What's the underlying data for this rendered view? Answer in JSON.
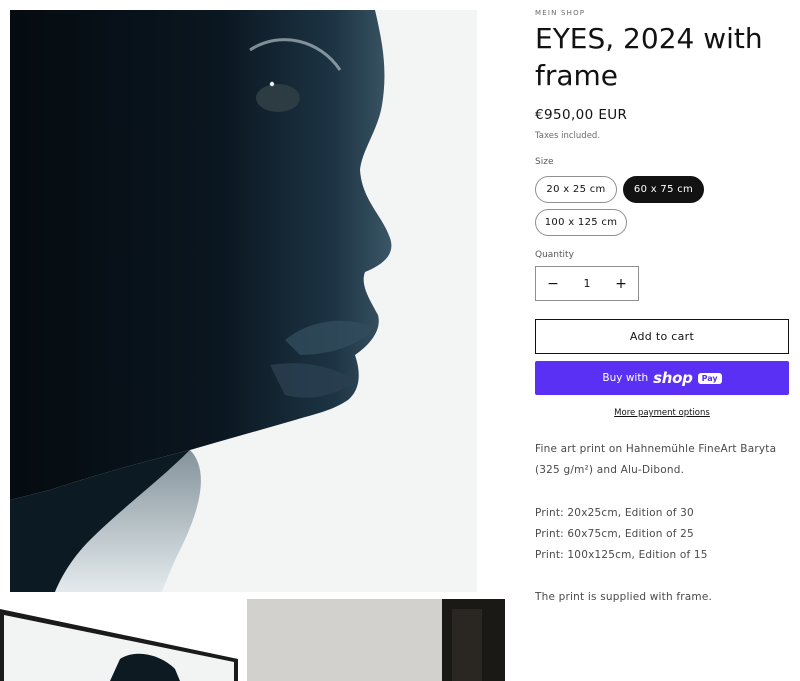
{
  "product": {
    "vendor": "MEIN SHOP",
    "title": "EYES, 2024 with frame",
    "price": "€950,00 EUR",
    "tax_note": "Taxes included."
  },
  "size": {
    "label": "Size",
    "options": [
      "20 x 25 cm",
      "60 x 75 cm",
      "100 x 125 cm"
    ],
    "selected": "60 x 75 cm"
  },
  "quantity": {
    "label": "Quantity",
    "value": "1",
    "decrement": "−",
    "increment": "+"
  },
  "buttons": {
    "add_to_cart": "Add to cart",
    "buy_with": "Buy with",
    "shop_word": "shop",
    "pay_badge": "Pay",
    "more_payment_options": "More payment options"
  },
  "description": {
    "line1": "Fine art print on Hahnemühle FineArt Baryta",
    "line2": "(325 g/m²) and Alu-Dibond.",
    "line3": "Print: 20x25cm, Edition of 30",
    "line4": "Print: 60x75cm, Edition of 25",
    "line5": "Print: 100x125cm, Edition of 15",
    "line6": "The print is supplied with frame."
  },
  "colors": {
    "shop_pay": "#5a31f4",
    "selected_pill": "#121212",
    "text": "#121212"
  }
}
